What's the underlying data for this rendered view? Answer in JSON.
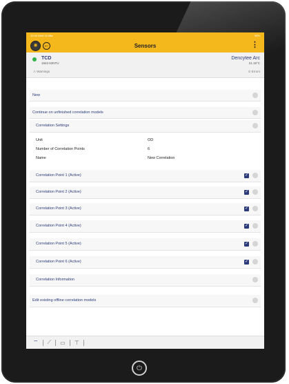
{
  "status_bar": {
    "time": "10:34",
    "date": "Wed 16 Mar",
    "battery": "98%"
  },
  "app_bar": {
    "title": "Sensors"
  },
  "device": {
    "name": "TCD",
    "serial": "1943 63NTU",
    "warnings_label": "Warnings",
    "right_name": "Dencytee Arc",
    "temperature": "21.19°C",
    "errors_label": "Errors"
  },
  "rows": {
    "new": "New",
    "continue": "Continue on unfinished correlation models",
    "settings": "Correlation Settings",
    "information": "Correlation Information",
    "edit_existing": "Edit existing offline correlation models"
  },
  "settings_fields": [
    {
      "label": "Unit",
      "value": "OD"
    },
    {
      "label": "Number of Correlation Points",
      "value": "6"
    },
    {
      "label": "Name",
      "value": "New Correlation"
    }
  ],
  "correlation_points": [
    {
      "label": "Correlation Point 1 (Active)",
      "checked": true
    },
    {
      "label": "Correlation Point 2 (Active)",
      "checked": true
    },
    {
      "label": "Correlation Point 3 (Active)",
      "checked": true
    },
    {
      "label": "Correlation Point 4 (Active)",
      "checked": true
    },
    {
      "label": "Correlation Point 5 (Active)",
      "checked": true
    },
    {
      "label": "Correlation Point 6 (Active)",
      "checked": true
    }
  ],
  "icons": {
    "logo": "gear-logo-icon",
    "back": "back-arrow-icon",
    "menu": "more-vertical-icon",
    "power": "power-icon"
  },
  "colors": {
    "accent": "#f5b81c",
    "primary": "#2a3a7a",
    "status_ok": "#2fb34a"
  }
}
